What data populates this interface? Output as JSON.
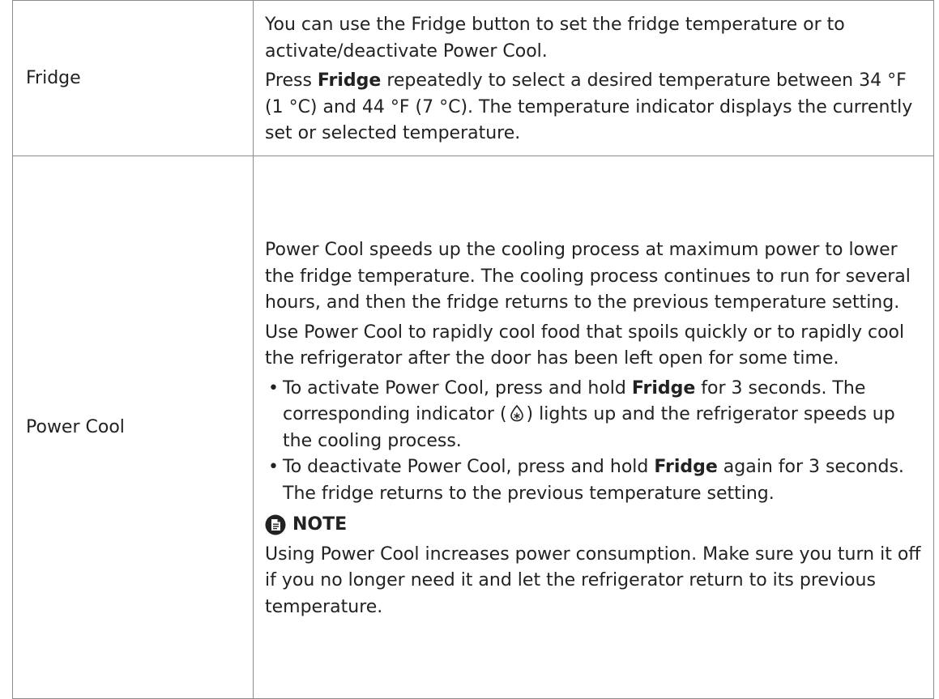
{
  "rows": [
    {
      "label": "Fridge",
      "paragraphs": {
        "p1": "You can use the Fridge button to set the fridge temperature or to activate/deactivate Power Cool.",
        "p2_pre": "Press ",
        "p2_bold": "Fridge",
        "p2_post": " repeatedly to select a desired temperature between 34 °F (1 °C) and 44 °F (7 °C). The temperature indicator displays the currently set or selected temperature."
      }
    },
    {
      "label": "Power Cool",
      "paragraphs": {
        "p1": "Power Cool speeds up the cooling process at maximum power to lower the fridge temperature. The cooling process continues to run for several hours, and then the fridge returns to the previous temperature setting.",
        "p2": "Use Power Cool to rapidly cool food that spoils quickly or to rapidly cool the refrigerator after the door has been left open for some time."
      },
      "bullets": [
        {
          "dot": "•",
          "pre": "To activate Power Cool, press and hold ",
          "bold": "Fridge",
          "mid": " for 3 seconds. The corresponding indicator (",
          "icon": "power-cool-indicator-icon",
          "post": ") lights up and the refrigerator speeds up the cooling process."
        },
        {
          "dot": "•",
          "pre": "To deactivate Power Cool, press and hold ",
          "bold": "Fridge",
          "post": " again for 3 seconds. The fridge returns to the previous temperature setting."
        }
      ],
      "note": {
        "icon": "note-icon",
        "heading": "NOTE",
        "text": "Using Power Cool increases power consumption. Make sure you turn it off if you no longer need it and let the refrigerator return to its previous temperature."
      }
    }
  ],
  "colors": {
    "text": "#222222",
    "border": "#8a8a8a"
  }
}
